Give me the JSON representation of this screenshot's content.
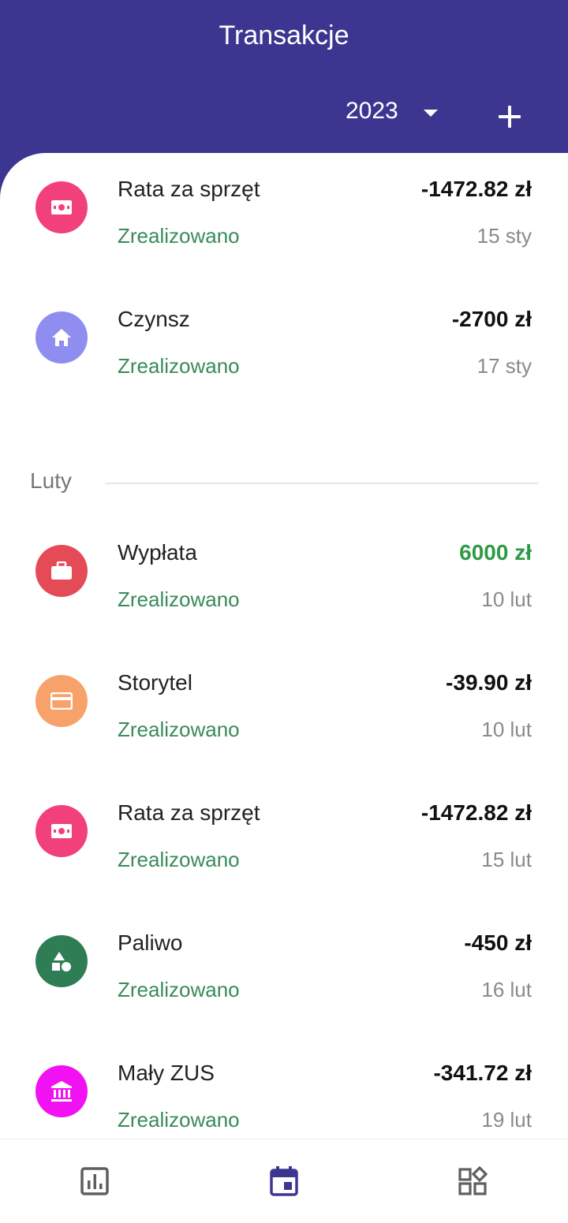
{
  "header": {
    "title": "Transakcje",
    "year": "2023"
  },
  "colors": {
    "primary": "#3d3690",
    "status_green": "#3a8a5a",
    "income_green": "#2e9a46"
  },
  "transactions": [
    {
      "name": "Rata za sprzęt",
      "status": "Zrealizowano",
      "amount": "-1472.82 zł",
      "date": "15 sty",
      "icon": "cash-icon",
      "color": "#f2407a"
    },
    {
      "name": "Czynsz",
      "status": "Zrealizowano",
      "amount": "-2700 zł",
      "date": "17 sty",
      "icon": "home-icon",
      "color": "#8f8ef0"
    }
  ],
  "month": {
    "label": "Luty"
  },
  "february": [
    {
      "name": "Wypłata",
      "status": "Zrealizowano",
      "amount": "6000 zł",
      "date": "10 lut",
      "icon": "briefcase-icon",
      "color": "#e54b57"
    },
    {
      "name": "Storytel",
      "status": "Zrealizowano",
      "amount": "-39.90 zł",
      "date": "10 lut",
      "icon": "credit-card-icon",
      "color": "#f7a26a"
    },
    {
      "name": "Rata za sprzęt",
      "status": "Zrealizowano",
      "amount": "-1472.82 zł",
      "date": "15 lut",
      "icon": "cash-icon",
      "color": "#f2407a"
    },
    {
      "name": "Paliwo",
      "status": "Zrealizowano",
      "amount": "-450 zł",
      "date": "16 lut",
      "icon": "category-icon",
      "color": "#2f7d54"
    },
    {
      "name": "Mały ZUS",
      "status": "Zrealizowano",
      "amount": "-341.72 zł",
      "date": "19 lut",
      "icon": "bank-icon",
      "color": "#f211f2"
    }
  ],
  "bottom_nav": [
    {
      "icon": "chart-icon",
      "active": false
    },
    {
      "icon": "calendar-icon",
      "active": true
    },
    {
      "icon": "categories-icon",
      "active": false
    }
  ]
}
